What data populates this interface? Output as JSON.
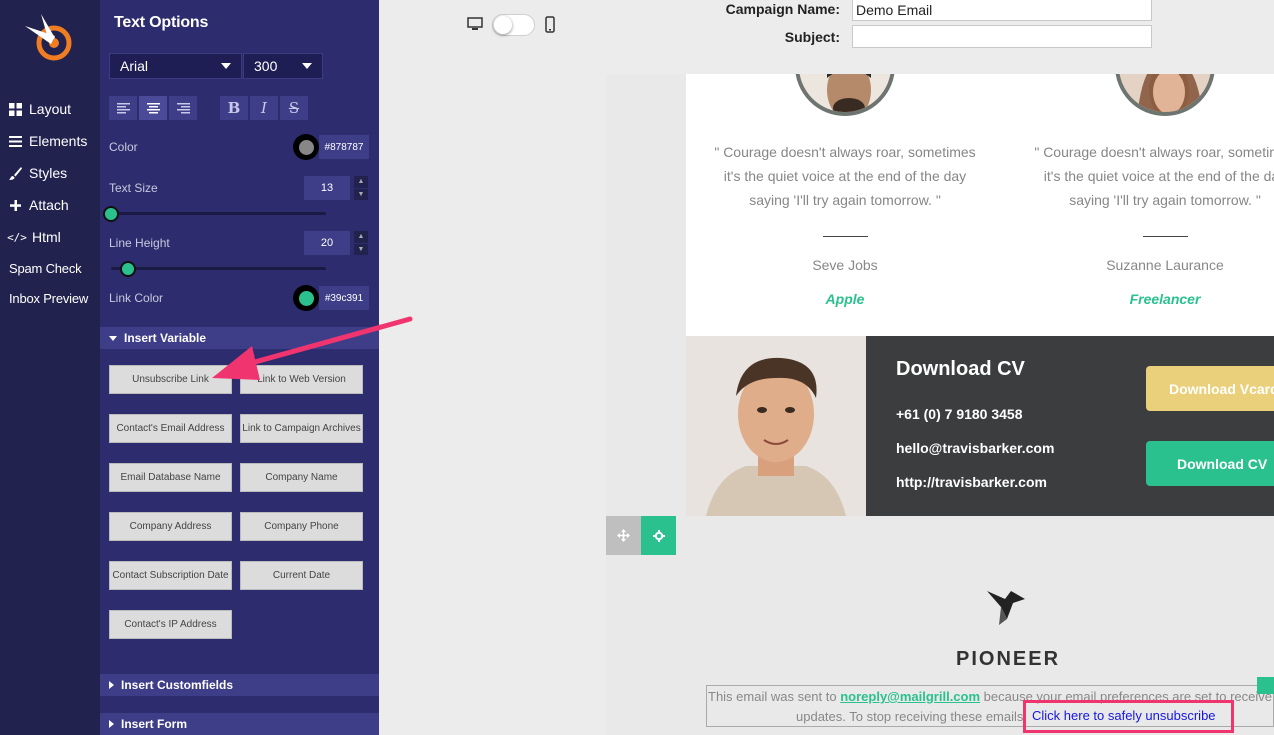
{
  "nav": {
    "items": [
      {
        "icon": "grid-icon",
        "label": "Layout"
      },
      {
        "icon": "list-icon",
        "label": "Elements"
      },
      {
        "icon": "brush-icon",
        "label": "Styles"
      },
      {
        "icon": "plus-icon",
        "label": "Attach"
      },
      {
        "icon": "code-icon",
        "label": "Html"
      },
      {
        "icon": "",
        "label": "Spam Check"
      },
      {
        "icon": "",
        "label": "Inbox Preview"
      }
    ]
  },
  "panel": {
    "title": "Text Options",
    "font_family": "Arial",
    "font_weight": "300",
    "color_label": "Color",
    "color_value": "#878787",
    "text_size_label": "Text Size",
    "text_size": "13",
    "line_height_label": "Line Height",
    "line_height": "20",
    "link_color_label": "Link Color",
    "link_color_value": "#39c391",
    "text_size_level": 0.0,
    "line_height_level": 0.08
  },
  "insert_variable": {
    "title": "Insert Variable",
    "buttons": [
      "Unsubscribe Link",
      "Link to Web Version",
      "Contact's Email Address",
      "Link to Campaign Archives",
      "Email Database Name",
      "Company Name",
      "Company Address",
      "Company Phone",
      "Contact Subscription Date",
      "Current Date",
      "Contact's IP Address"
    ]
  },
  "sections": {
    "customfields": "Insert Customfields",
    "form": "Insert Form"
  },
  "header": {
    "campaign_label": "Campaign Name:",
    "campaign_value": "Demo Email",
    "subject_label": "Subject:",
    "subject_value": ""
  },
  "email": {
    "testimonials": [
      {
        "quote_lines": [
          "\" Courage doesn't always roar, sometimes",
          "it's the quiet voice at the end of the day",
          "saying 'I'll try again tomorrow. \""
        ],
        "name": "Seve Jobs",
        "role": "Apple"
      },
      {
        "quote_lines": [
          "\" Courage doesn't always roar, sometimes",
          "it's the quiet voice at the end of the day",
          "saying 'I'll try again tomorrow. \""
        ],
        "name": "Suzanne Laurance",
        "role": "Freelancer"
      }
    ],
    "cv": {
      "title": "Download CV",
      "phone": "+61 (0) 7 9180 3458",
      "email": "hello@travisbarker.com",
      "url": "http://travisbarker.com",
      "vcard_button": "Download Vcard",
      "cv_button": "Download CV"
    },
    "brand": "PIONEER",
    "footer": {
      "text_before": "This email was sent to ",
      "email": "noreply@mailgrill.com",
      "text_after": " because your email preferences are set to receive",
      "line2": "updates. To stop receiving these emails ",
      "unsubscribe_link": "Click here to safely unsubscribe"
    }
  },
  "colors": {
    "nav_bg": "#22224e",
    "panel_bg": "#2c2c6e",
    "accent": "#2bc18e",
    "vcard": "#ead07a",
    "highlight": "#f0346f"
  }
}
